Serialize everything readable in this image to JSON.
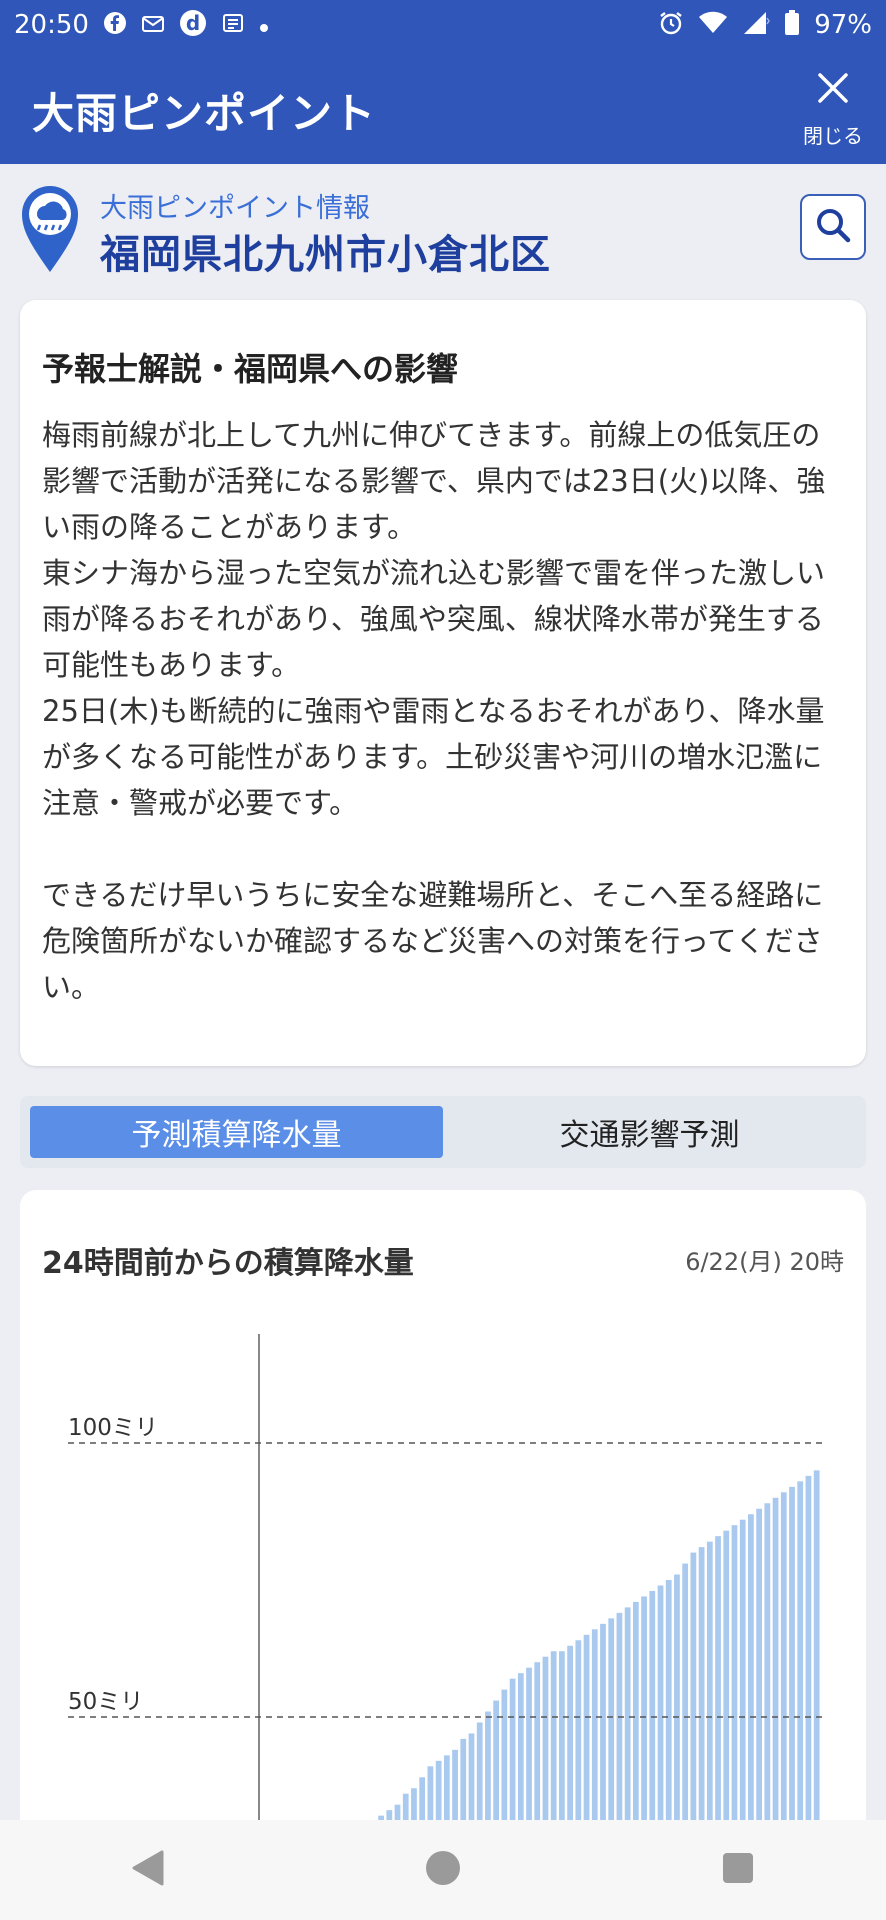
{
  "status_bar": {
    "time": "20:50",
    "battery": "97%",
    "app_icons": [
      "facebook-icon",
      "mail-icon",
      "d-icon",
      "news-icon",
      "dot-icon"
    ],
    "right_icons": [
      "alarm-icon",
      "wifi-icon",
      "signal-icon",
      "battery-icon"
    ]
  },
  "appbar": {
    "title": "大雨ピンポイント",
    "close_label": "閉じる"
  },
  "location": {
    "subtitle": "大雨ピンポイント情報",
    "name": "福岡県北九州市小倉北区"
  },
  "commentary": {
    "heading": "予報士解説・福岡県への影響",
    "para1": "梅雨前線が北上して九州に伸びてきます。前線上の低気圧の影響で活動が活発になる影響で、県内では23日(火)以降、強い雨の降ることがあります。",
    "para2": "東シナ海から湿った空気が流れ込む影響で雷を伴った激しい雨が降るおそれがあり、強風や突風、線状降水帯が発生する可能性もあります。",
    "para3": "25日(木)も断続的に強雨や雷雨となるおそれがあり、降水量が多くなる可能性があります。土砂災害や河川の増水氾濫に注意・警戒が必要です。",
    "para4": "できるだけ早いうちに安全な避難場所と、そこへ至る経路に危険箇所がないか確認するなど災害への対策を行ってください。"
  },
  "tabs": [
    {
      "label": "予測積算降水量",
      "active": true
    },
    {
      "label": "交通影響予測",
      "active": false
    }
  ],
  "chart": {
    "title": "24時間前からの積算降水量",
    "timestamp": "6/22(月) 20時"
  },
  "chart_data": {
    "type": "bar",
    "title": "24時間前からの積算降水量",
    "ylim": [
      0,
      120
    ],
    "reference_lines": [
      {
        "label": "100ミリ",
        "value": 100
      },
      {
        "label": "50ミリ",
        "value": 50
      }
    ],
    "values": [
      0,
      0,
      0,
      0,
      0,
      0,
      0,
      0,
      0,
      0,
      0,
      0,
      0,
      0,
      0,
      0,
      0,
      0,
      0,
      0,
      0,
      0,
      0,
      0,
      0,
      0,
      0,
      0,
      0,
      0,
      0,
      0,
      0,
      0,
      0,
      0,
      0,
      0,
      0,
      0,
      0,
      0,
      0,
      0,
      0,
      0,
      0,
      0,
      0,
      0,
      0,
      0,
      0,
      0,
      0,
      0,
      0,
      0,
      0,
      0,
      0,
      31,
      32,
      33,
      34,
      36,
      37,
      39,
      41,
      42,
      43,
      44,
      46,
      47,
      49,
      51,
      53,
      55,
      57,
      58,
      59,
      60,
      61,
      62,
      62,
      63,
      64,
      65,
      66,
      67,
      68,
      69,
      70,
      71,
      72,
      73,
      74,
      75,
      76,
      78,
      80,
      81,
      82,
      83,
      84,
      85,
      86,
      87,
      88,
      89,
      90,
      91,
      92,
      93,
      94,
      95
    ],
    "colors": {
      "bar": "#a9c9ef",
      "axis": "#888888",
      "grid": "#555555"
    }
  },
  "navbar": {
    "buttons": [
      "back-icon",
      "home-icon",
      "recents-icon"
    ]
  }
}
